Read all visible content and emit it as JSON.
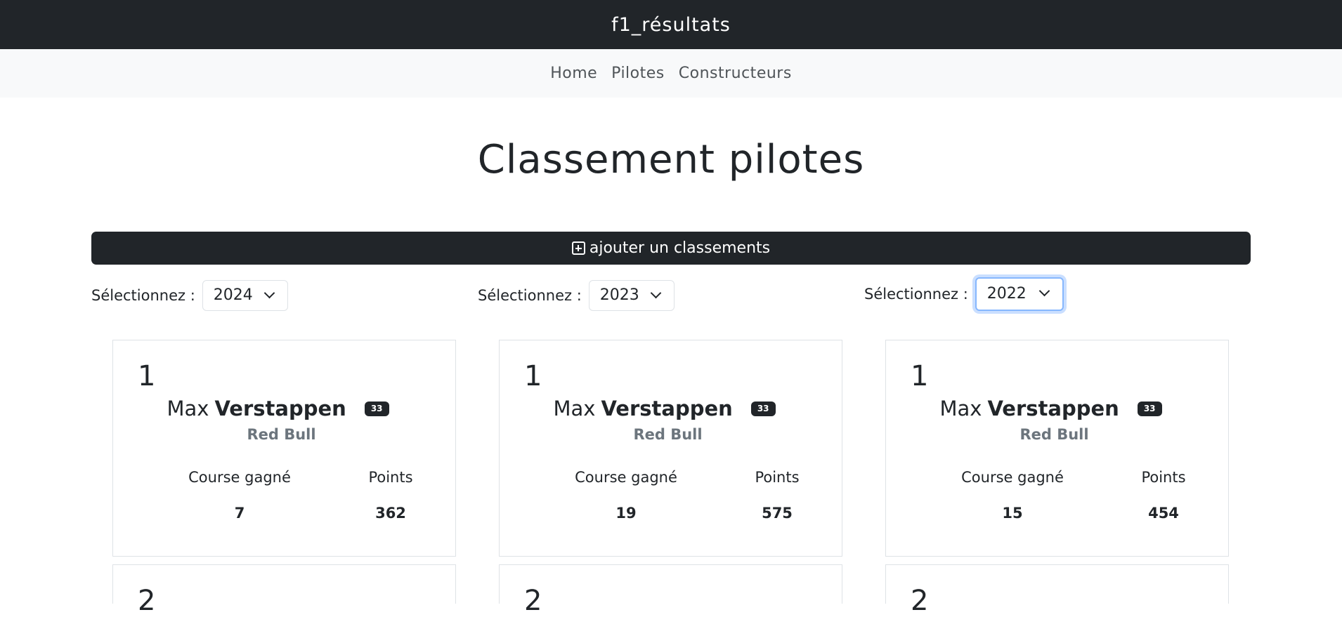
{
  "app": {
    "title": "f1_résultats"
  },
  "nav": {
    "items": [
      "Home",
      "Pilotes",
      "Constructeurs"
    ]
  },
  "page": {
    "title": "Classement pilotes"
  },
  "toolbar": {
    "add_label": "ajouter un classements"
  },
  "columns": [
    {
      "select_label": "Sélectionnez :",
      "selected_year": "2024",
      "focused": false,
      "card": {
        "rank": "1",
        "first_name": "Max",
        "last_name": "Verstappen",
        "number": "33",
        "team": "Red Bull",
        "wins_label": "Course gagné",
        "points_label": "Points",
        "wins": "7",
        "points": "362"
      },
      "next_rank": "2"
    },
    {
      "select_label": "Sélectionnez :",
      "selected_year": "2023",
      "focused": false,
      "card": {
        "rank": "1",
        "first_name": "Max",
        "last_name": "Verstappen",
        "number": "33",
        "team": "Red Bull",
        "wins_label": "Course gagné",
        "points_label": "Points",
        "wins": "19",
        "points": "575"
      },
      "next_rank": "2"
    },
    {
      "select_label": "Sélectionnez :",
      "selected_year": "2022",
      "focused": true,
      "card": {
        "rank": "1",
        "first_name": "Max",
        "last_name": "Verstappen",
        "number": "33",
        "team": "Red Bull",
        "wins_label": "Course gagné",
        "points_label": "Points",
        "wins": "15",
        "points": "454"
      },
      "next_rank": "2"
    }
  ]
}
